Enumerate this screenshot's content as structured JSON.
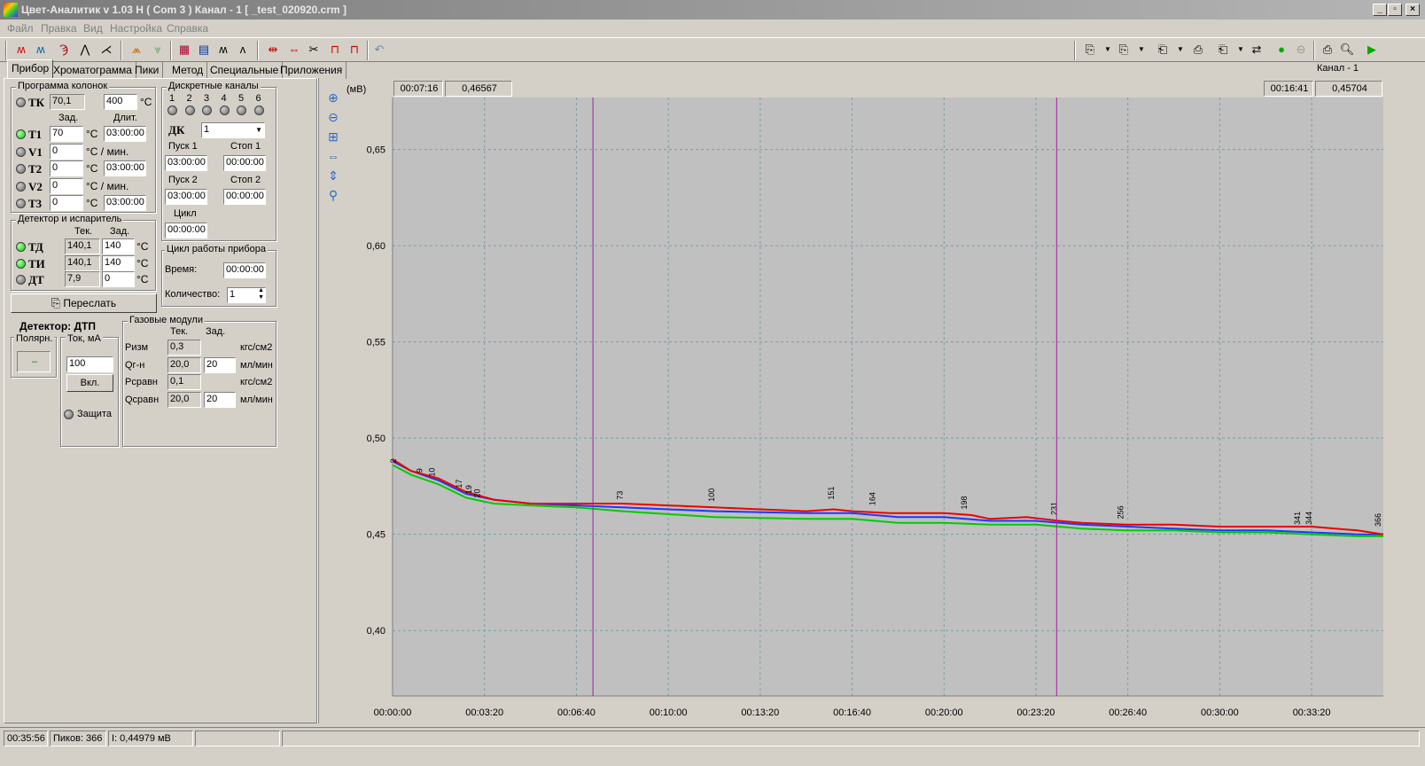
{
  "window": {
    "title": "Цвет-Аналитик v 1.03 H ( Com 3 ) Канал - 1 [ _test_020920.crm ]",
    "btn_min": "_",
    "btn_max": "▫",
    "btn_close": "×"
  },
  "menu": [
    "Файл",
    "Правка",
    "Вид",
    "Настройка",
    "Справка"
  ],
  "tabs": [
    "Прибор",
    "Хроматограмма",
    "Пики",
    "Метод",
    "Специальные",
    "Приложения"
  ],
  "channel_label": "Канал - 1",
  "columns": {
    "title": "Программа колонок",
    "tk_label": "ТК",
    "tk_current": "70,1",
    "tk_set": "400",
    "unit_c": "°С",
    "hdr_set": "Зад.",
    "hdr_dur": "Длит.",
    "rows": [
      {
        "label": "Т1",
        "led": "green",
        "value": "70",
        "unit": "°С",
        "dur": "03:00:00"
      },
      {
        "label": "V1",
        "led": "gray",
        "value": "0",
        "unit": "°С / мин.",
        "dur": ""
      },
      {
        "label": "Т2",
        "led": "gray",
        "value": "0",
        "unit": "°С",
        "dur": "03:00:00"
      },
      {
        "label": "V2",
        "led": "gray",
        "value": "0",
        "unit": "°С / мин.",
        "dur": ""
      },
      {
        "label": "Т3",
        "led": "gray",
        "value": "0",
        "unit": "°С",
        "dur": "03:00:00"
      }
    ]
  },
  "detector_evap": {
    "title": "Детектор и испаритель",
    "hdr_cur": "Тек.",
    "hdr_set": "Зад.",
    "rows": [
      {
        "label": "ТД",
        "led": "green",
        "cur": "140,1",
        "set": "140",
        "unit": "°С"
      },
      {
        "label": "ТИ",
        "led": "green",
        "cur": "140,1",
        "set": "140",
        "unit": "°С"
      },
      {
        "label": "ДТ",
        "led": "gray",
        "cur": "7,9",
        "set": "0",
        "unit": "°С"
      }
    ]
  },
  "send_button": "Переслать",
  "discrete": {
    "title": "Дискретные каналы",
    "channels": [
      "1",
      "2",
      "3",
      "4",
      "5",
      "6"
    ],
    "dk_label": "ДК",
    "dk_value": "1",
    "start1_label": "Пуск 1",
    "stop1_label": "Стоп 1",
    "start1": "03:00:00",
    "stop1": "00:00:00",
    "start2_label": "Пуск 2",
    "stop2_label": "Стоп 2",
    "start2": "03:00:00",
    "stop2": "00:00:00",
    "cycle_label": "Цикл",
    "cycle": "00:00:00"
  },
  "device_cycle": {
    "title": "Цикл работы прибора",
    "time_label": "Время:",
    "time": "00:00:00",
    "count_label": "Количество:",
    "count": "1"
  },
  "detector": {
    "title": "Детектор: ДТП",
    "polarity_label": "Полярн.",
    "polarity": "–",
    "current_label": "Ток, мА",
    "current": "100",
    "on_button": "Вкл.",
    "protect_label": "Защита"
  },
  "gas": {
    "title": "Газовые модули",
    "hdr_cur": "Тек.",
    "hdr_set": "Зад.",
    "rows": [
      {
        "label": "Ризм",
        "cur": "0,3",
        "set": "",
        "unit": "кгс/см2"
      },
      {
        "label": "Qг-н",
        "cur": "20,0",
        "set": "20",
        "unit": "мл/мин"
      },
      {
        "label": "Рсравн",
        "cur": "0,1",
        "set": "",
        "unit": "кгс/см2"
      },
      {
        "label": "Qсравн",
        "cur": "20,0",
        "set": "20",
        "unit": "мл/мин"
      }
    ]
  },
  "cursor_left": {
    "time": "00:07:16",
    "value": "0,46567"
  },
  "cursor_right": {
    "time": "00:16:41",
    "value": "0,45704"
  },
  "status": {
    "time": "00:35:56",
    "peaks": "Пиков: 366",
    "intensity": "I: 0,44979 мВ"
  },
  "chart_data": {
    "type": "line",
    "ylabel": "(мВ)",
    "xlim_seconds": [
      0,
      2156
    ],
    "ylim": [
      0.366,
      0.677
    ],
    "yticks": [
      "0,65",
      "0,60",
      "0,55",
      "0,50",
      "0,45",
      "0,40"
    ],
    "ytick_values": [
      0.65,
      0.6,
      0.55,
      0.5,
      0.45,
      0.4
    ],
    "xticks": [
      "00:00:00",
      "00:03:20",
      "00:06:40",
      "00:10:00",
      "00:13:20",
      "00:16:40",
      "00:20:00",
      "00:23:20",
      "00:26:40",
      "00:30:00",
      "00:33:20"
    ],
    "xtick_values": [
      0,
      200,
      400,
      600,
      800,
      1000,
      1200,
      1400,
      1600,
      1800,
      2000
    ],
    "cursors_seconds": [
      436,
      1445
    ],
    "grid": true,
    "series": [
      {
        "color": "#1a3aff",
        "x": [
          0,
          40,
          100,
          160,
          220,
          300,
          400,
          500,
          700,
          900,
          1000,
          1100,
          1200,
          1300,
          1400,
          1500,
          1600,
          1700,
          1800,
          1900,
          2000,
          2100,
          2156
        ],
        "y": [
          0.488,
          0.483,
          0.478,
          0.471,
          0.468,
          0.466,
          0.465,
          0.464,
          0.462,
          0.461,
          0.461,
          0.459,
          0.459,
          0.457,
          0.457,
          0.455,
          0.454,
          0.453,
          0.452,
          0.452,
          0.451,
          0.45,
          0.45
        ]
      },
      {
        "color": "#00cc00",
        "x": [
          0,
          40,
          100,
          160,
          220,
          300,
          400,
          500,
          700,
          900,
          1000,
          1100,
          1200,
          1300,
          1400,
          1500,
          1600,
          1700,
          1800,
          1900,
          2000,
          2100,
          2156
        ],
        "y": [
          0.486,
          0.481,
          0.476,
          0.469,
          0.466,
          0.465,
          0.464,
          0.462,
          0.459,
          0.458,
          0.458,
          0.456,
          0.456,
          0.455,
          0.455,
          0.453,
          0.452,
          0.452,
          0.451,
          0.451,
          0.45,
          0.449,
          0.449
        ]
      },
      {
        "color": "#ee0000",
        "x": [
          0,
          40,
          100,
          160,
          220,
          300,
          400,
          500,
          600,
          700,
          800,
          900,
          960,
          1000,
          1080,
          1200,
          1260,
          1300,
          1380,
          1450,
          1500,
          1600,
          1700,
          1800,
          1900,
          2000,
          2100,
          2156
        ],
        "y": [
          0.489,
          0.483,
          0.479,
          0.472,
          0.468,
          0.466,
          0.466,
          0.466,
          0.465,
          0.464,
          0.463,
          0.462,
          0.463,
          0.462,
          0.461,
          0.461,
          0.46,
          0.458,
          0.459,
          0.457,
          0.456,
          0.455,
          0.455,
          0.454,
          0.454,
          0.454,
          0.452,
          0.45
        ]
      }
    ],
    "peak_labels": [
      {
        "x": 8,
        "y": 0.487,
        "text": "2"
      },
      {
        "x": 65,
        "y": 0.482,
        "text": "9"
      },
      {
        "x": 92,
        "y": 0.48,
        "text": "10"
      },
      {
        "x": 150,
        "y": 0.474,
        "text": "17"
      },
      {
        "x": 172,
        "y": 0.471,
        "text": "19"
      },
      {
        "x": 190,
        "y": 0.469,
        "text": "20"
      },
      {
        "x": 500,
        "y": 0.468,
        "text": "73"
      },
      {
        "x": 700,
        "y": 0.467,
        "text": "100"
      },
      {
        "x": 960,
        "y": 0.468,
        "text": "151"
      },
      {
        "x": 1050,
        "y": 0.465,
        "text": "164"
      },
      {
        "x": 1250,
        "y": 0.463,
        "text": "198"
      },
      {
        "x": 1445,
        "y": 0.46,
        "text": "231"
      },
      {
        "x": 1590,
        "y": 0.458,
        "text": "256"
      },
      {
        "x": 1975,
        "y": 0.455,
        "text": "341"
      },
      {
        "x": 2000,
        "y": 0.455,
        "text": "344"
      },
      {
        "x": 2150,
        "y": 0.454,
        "text": "366"
      }
    ]
  }
}
